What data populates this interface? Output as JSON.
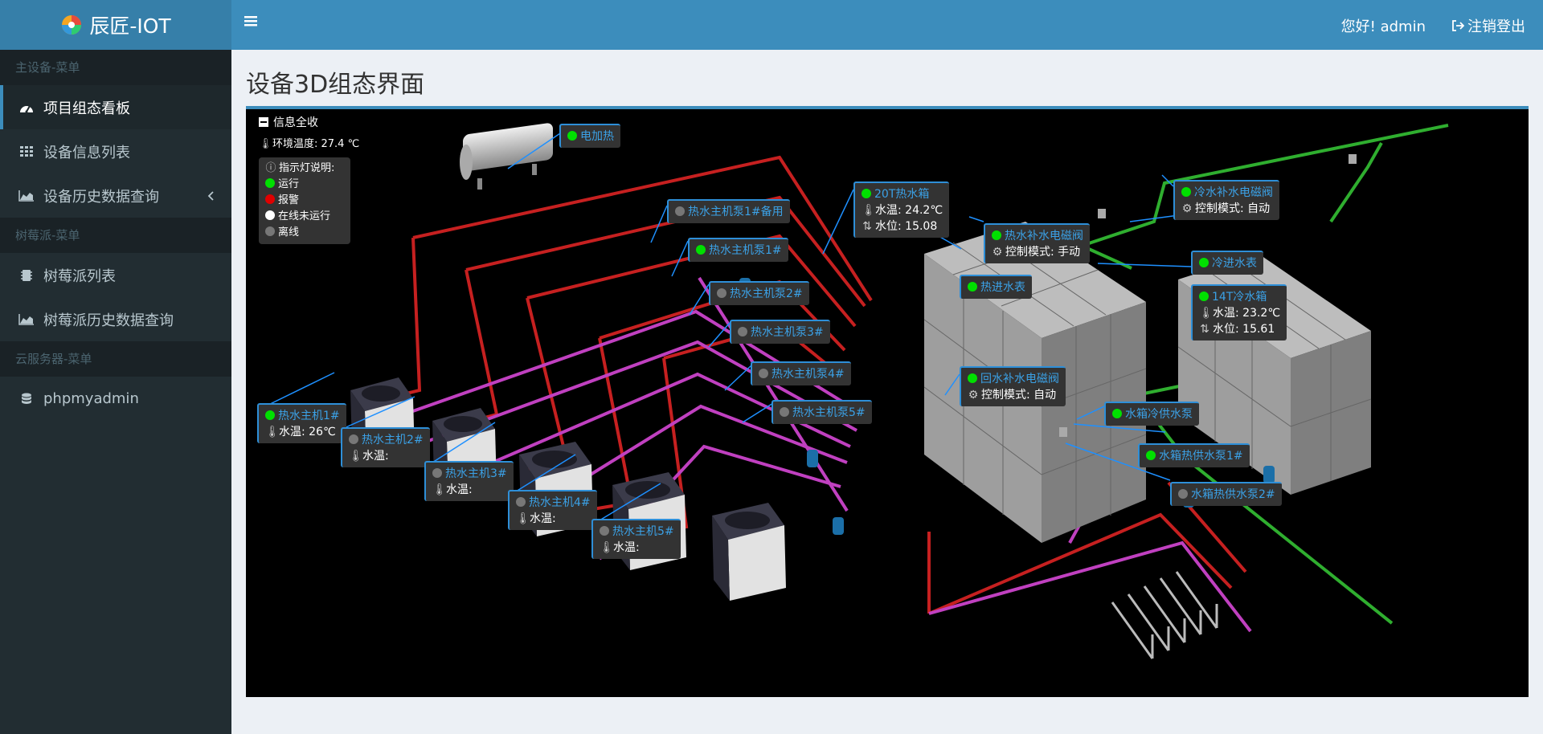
{
  "app": {
    "title": "辰匠-IOT"
  },
  "header": {
    "greeting": "您好!  admin",
    "logout_label": "注销登出"
  },
  "sidebar": {
    "sections": [
      {
        "title": "主设备-菜单",
        "items": [
          {
            "label": "项目组态看板",
            "icon": "dashboard-icon",
            "active": true
          },
          {
            "label": "设备信息列表",
            "icon": "grid-icon"
          },
          {
            "label": "设备历史数据查询",
            "icon": "area-chart-icon",
            "has_children": true
          }
        ]
      },
      {
        "title": "树莓派-菜单",
        "items": [
          {
            "label": "树莓派列表",
            "icon": "chip-icon"
          },
          {
            "label": "树莓派历史数据查询",
            "icon": "area-chart-icon"
          }
        ]
      },
      {
        "title": "云服务器-菜单",
        "items": [
          {
            "label": "phpmyadmin",
            "icon": "database-icon"
          }
        ]
      }
    ]
  },
  "page": {
    "title": "设备3D组态界面"
  },
  "scene": {
    "collapse_label": "信息全收",
    "ambient": "环境温度: 27.4 ℃",
    "legend": {
      "title": "指示灯说明:",
      "items": [
        {
          "label": "运行",
          "color": "#00e000"
        },
        {
          "label": "报警",
          "color": "#e00000"
        },
        {
          "label": "在线未运行",
          "color": "#ffffff"
        },
        {
          "label": "离线",
          "color": "#777777"
        }
      ]
    },
    "labels": {
      "heater": {
        "name": "电加热",
        "status": "on"
      },
      "tank20": {
        "name": "20T热水箱",
        "temp_label": "水温:",
        "temp": "24.2℃",
        "level_label": "水位:",
        "level": "15.08",
        "status": "on"
      },
      "hot_valve": {
        "name": "热水补水电磁阀",
        "mode_label": "控制模式:",
        "mode": "手动",
        "status": "on"
      },
      "hot_meter": {
        "name": "热进水表",
        "status": "on"
      },
      "cold_valve": {
        "name": "冷水补水电磁阀",
        "mode_label": "控制模式:",
        "mode": "自动",
        "status": "on"
      },
      "cold_meter": {
        "name": "冷进水表",
        "status": "on"
      },
      "tank14": {
        "name": "14T冷水箱",
        "temp_label": "水温:",
        "temp": "23.2℃",
        "level_label": "水位:",
        "level": "15.61",
        "status": "on"
      },
      "return_valve": {
        "name": "回水补水电磁阀",
        "mode_label": "控制模式:",
        "mode": "自动",
        "status": "on"
      },
      "pump_backup": {
        "name": "热水主机泵1#备用",
        "status": "off"
      },
      "pump1": {
        "name": "热水主机泵1#",
        "status": "on"
      },
      "pump2": {
        "name": "热水主机泵2#",
        "status": "off"
      },
      "pump3": {
        "name": "热水主机泵3#",
        "status": "off"
      },
      "pump4": {
        "name": "热水主机泵4#",
        "status": "off"
      },
      "pump5": {
        "name": "热水主机泵5#",
        "status": "off"
      },
      "cold_supply": {
        "name": "水箱冷供水泵",
        "status": "on"
      },
      "hot_supply1": {
        "name": "水箱热供水泵1#",
        "status": "on"
      },
      "hot_supply2": {
        "name": "水箱热供水泵2#",
        "status": "off"
      },
      "unit1": {
        "name": "热水主机1#",
        "temp_label": "水温:",
        "temp": "26℃",
        "status": "on"
      },
      "unit2": {
        "name": "热水主机2#",
        "temp_label": "水温:",
        "temp": "",
        "status": "off"
      },
      "unit3": {
        "name": "热水主机3#",
        "temp_label": "水温:",
        "temp": "",
        "status": "off"
      },
      "unit4": {
        "name": "热水主机4#",
        "temp_label": "水温:",
        "temp": "",
        "status": "off"
      },
      "unit5": {
        "name": "热水主机5#",
        "temp_label": "水温:",
        "temp": "",
        "status": "off"
      }
    }
  }
}
